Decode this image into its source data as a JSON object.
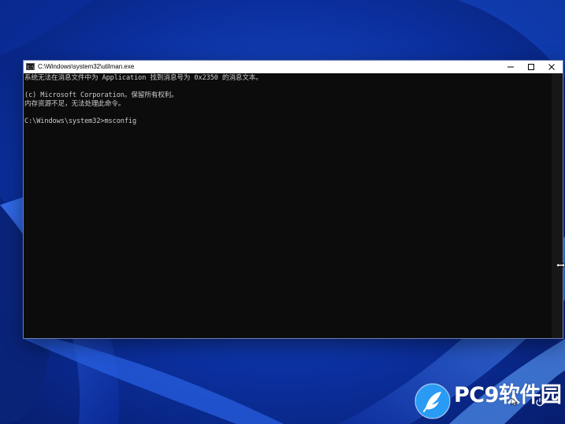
{
  "window": {
    "title": "C:\\Windows\\system32\\utilman.exe",
    "icon": "cmd-icon",
    "buttons": [
      "minimize-icon",
      "maximize-icon",
      "close-icon"
    ]
  },
  "console": {
    "lines": [
      "系统无法在消息文件中为 Application 找到消息号为 0x2350 的消息文本。",
      "",
      "(c) Microsoft Corporation。保留所有权利。",
      "内存资源不足，无法处理此命令。",
      "",
      "C:\\Windows\\system32>msconfig"
    ],
    "text_color": "#cccccc",
    "background": "#0c0c0c"
  },
  "watermark": {
    "text": "PC9软件园",
    "logo": "pc9-logo-icon"
  },
  "colors": {
    "wallpaper_base": "#0a2a8c",
    "wallpaper_highlight": "#3f7fff",
    "title_bar": "#ffffff"
  }
}
